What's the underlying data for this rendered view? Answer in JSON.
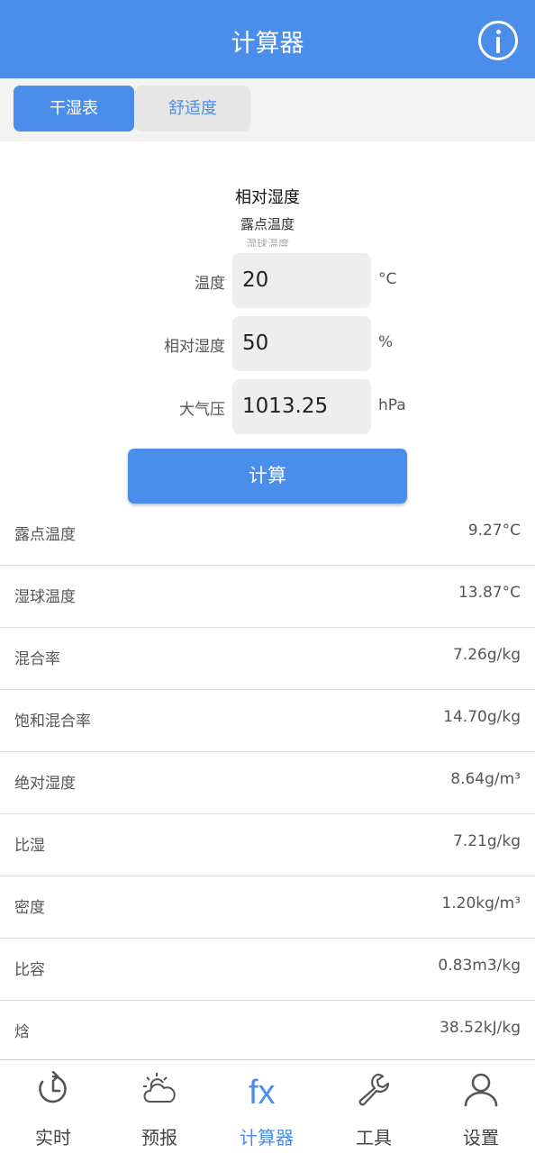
{
  "header": {
    "title": "计算器",
    "info_icon": "info-circle-icon"
  },
  "tabs": [
    {
      "label": "干湿表",
      "active": true
    },
    {
      "label": "舒适度",
      "active": false
    }
  ],
  "mode_picker": {
    "selected": "相对湿度",
    "next": "露点温度",
    "next2": "湿球温度"
  },
  "form": {
    "temperature": {
      "label": "温度",
      "value": "20",
      "unit": "°C"
    },
    "humidity": {
      "label": "相对湿度",
      "value": "50",
      "unit": "%"
    },
    "pressure": {
      "label": "大气压",
      "value": "1013.25",
      "unit": "hPa"
    }
  },
  "calculate_label": "计算",
  "results": [
    {
      "label": "露点温度",
      "value": "9.27°C"
    },
    {
      "label": "湿球温度",
      "value": "13.87°C"
    },
    {
      "label": "混合率",
      "value": "7.26g/kg"
    },
    {
      "label": "饱和混合率",
      "value": "14.70g/kg"
    },
    {
      "label": "绝对湿度",
      "value": "8.64g/m³"
    },
    {
      "label": "比湿",
      "value": "7.21g/kg"
    },
    {
      "label": "密度",
      "value": "1.20kg/m³"
    },
    {
      "label": "比容",
      "value": "0.83m3/kg"
    },
    {
      "label": "焓",
      "value": "38.52kJ/kg"
    }
  ],
  "bottom_nav": [
    {
      "label": "实时",
      "icon": "clock-history-icon",
      "active": false
    },
    {
      "label": "预报",
      "icon": "sun-cloud-icon",
      "active": false
    },
    {
      "label": "计算器",
      "icon": "fx-icon",
      "active": true
    },
    {
      "label": "工具",
      "icon": "wrench-icon",
      "active": false
    },
    {
      "label": "设置",
      "icon": "person-icon",
      "active": false
    }
  ],
  "colors": {
    "accent": "#4a8deb",
    "background": "#ffffff",
    "tab_bar": "#f3f3f3",
    "field": "#eeeeee"
  }
}
